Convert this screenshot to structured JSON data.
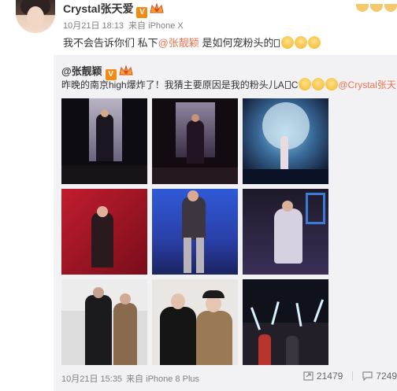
{
  "post": {
    "author": "Crystal张天爱",
    "verified_badge": "V",
    "time": "10月21日 18:13",
    "source_prefix": "来自",
    "source": "iPhone X",
    "text_before": "我不会告诉你们 私下",
    "mention": "@张靓颖",
    "text_after": " 是如何宠粉头的"
  },
  "repost": {
    "author": "@张靓颖",
    "verified_badge": "V",
    "text": "昨晚的南京high爆炸了！我猜主要原因是我的粉头儿A",
    "text_tail": "C",
    "mention": "@Crystal张天",
    "time": "10月21日 15:35",
    "source_prefix": "来自",
    "source": "iPhone 8 Plus",
    "repost_count": "21479",
    "comment_count": "7249"
  },
  "colors": {
    "accent": "#eb7350",
    "verified": "#f28a16",
    "repost_bg": "#f2f2f5",
    "meta_text": "#808080"
  }
}
